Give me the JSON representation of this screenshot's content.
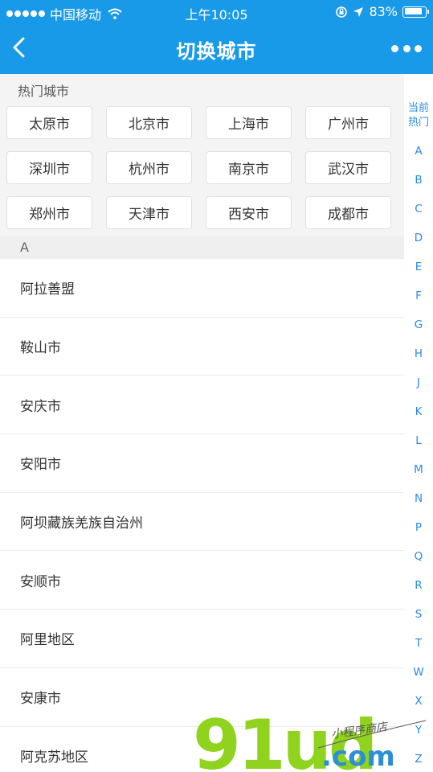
{
  "status_bar": {
    "carrier": "中国移动",
    "time": "上午10:05",
    "battery": "83%"
  },
  "nav": {
    "title": "切换城市"
  },
  "hot": {
    "header": "热门城市",
    "cities": [
      "太原市",
      "北京市",
      "上海市",
      "广州市",
      "深圳市",
      "杭州市",
      "南京市",
      "武汉市",
      "郑州市",
      "天津市",
      "西安市",
      "成都市"
    ]
  },
  "list": {
    "letter": "A",
    "items": [
      "阿拉善盟",
      "鞍山市",
      "安庆市",
      "安阳市",
      "阿坝藏族羌族自治州",
      "安顺市",
      "阿里地区",
      "安康市",
      "阿克苏地区"
    ]
  },
  "index": {
    "current_line1": "当前",
    "current_line2": "热门",
    "letters": [
      "A",
      "B",
      "C",
      "D",
      "E",
      "F",
      "G",
      "H",
      "J",
      "K",
      "L",
      "M",
      "N",
      "P",
      "Q",
      "R",
      "S",
      "T",
      "W",
      "X",
      "Y",
      "Z"
    ]
  },
  "watermark": {
    "logo": "91ud",
    "domain": ".com",
    "tagline": "小程序商店"
  },
  "colors": {
    "brand": "#199ae8",
    "index_text": "#2a8ae6",
    "watermark_green": "#8fd31f",
    "watermark_blue": "#2c8fd6"
  }
}
